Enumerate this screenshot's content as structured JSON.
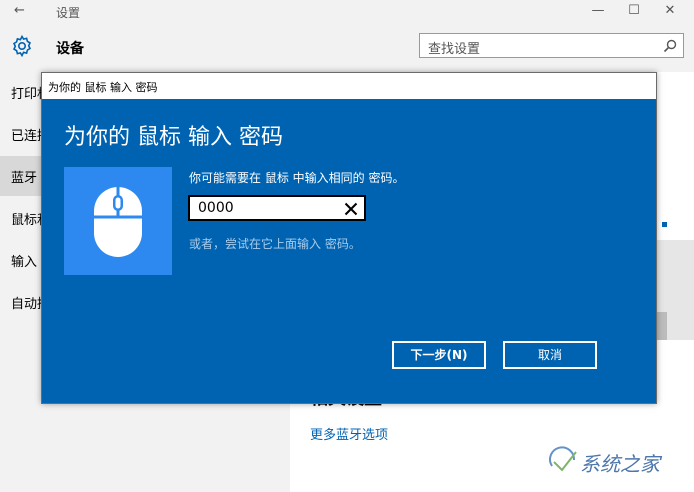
{
  "window": {
    "back_glyph": "←",
    "title": "设置",
    "min_glyph": "—",
    "max_glyph": "☐",
    "close_glyph": "✕"
  },
  "header": {
    "title": "设备",
    "search_placeholder": "查找设置"
  },
  "sidebar": {
    "items": [
      {
        "label": "打印机"
      },
      {
        "label": "已连接"
      },
      {
        "label": "蓝牙"
      },
      {
        "label": "鼠标和"
      },
      {
        "label": "输入"
      },
      {
        "label": "自动播"
      }
    ],
    "selected_index": 2
  },
  "background": {
    "heading": "相关设置",
    "link": "更多蓝牙选项",
    "watermark": "系统之家"
  },
  "dialog": {
    "window_title": "为你的 鼠标 输入 密码",
    "heading": "为你的 鼠标 输入 密码",
    "message": "你可能需要在 鼠标 中输入相同的 密码。",
    "pin_value": "0000",
    "alt_text": "或者，尝试在它上面输入 密码。",
    "next_label": "下一步(N)",
    "cancel_label": "取消"
  },
  "colors": {
    "accent": "#0063b1",
    "tile": "#2d89ef",
    "chrome": "#f2f2f2"
  }
}
